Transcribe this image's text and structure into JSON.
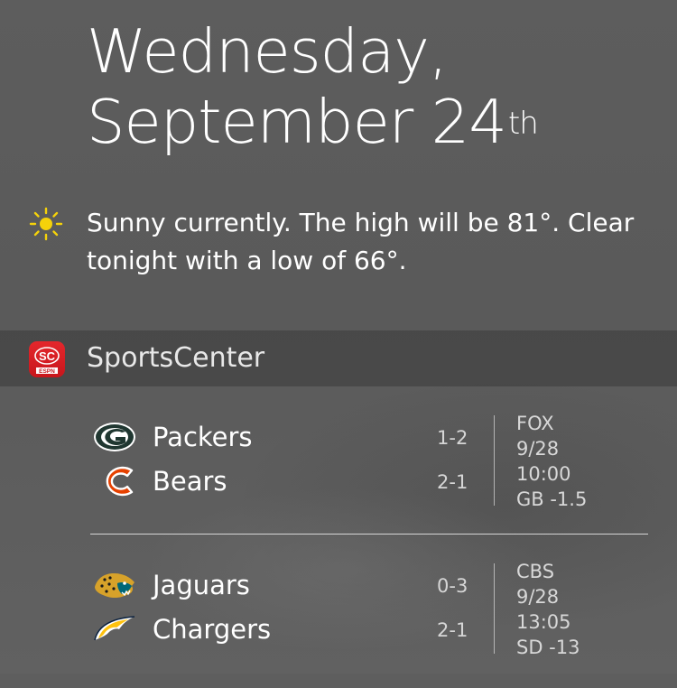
{
  "date": {
    "weekday": "Wednesday,",
    "month_day": "September 24",
    "suffix": "th"
  },
  "weather": {
    "icon": "sun-icon",
    "text": "Sunny currently. The high will be 81°. Clear tonight with a low of 66°."
  },
  "section": {
    "app_icon": "sportscenter-app-icon",
    "icon_badge": "SC",
    "icon_sub": "ESPN",
    "title": "SportsCenter"
  },
  "games": [
    {
      "teams": [
        {
          "name": "Packers",
          "record": "1-2",
          "logo": "packers-logo-icon"
        },
        {
          "name": "Bears",
          "record": "2-1",
          "logo": "bears-logo-icon"
        }
      ],
      "info": {
        "network": "FOX",
        "date": "9/28",
        "time": "10:00",
        "line": "GB -1.5"
      }
    },
    {
      "teams": [
        {
          "name": "Jaguars",
          "record": "0-3",
          "logo": "jaguars-logo-icon"
        },
        {
          "name": "Chargers",
          "record": "2-1",
          "logo": "chargers-logo-icon"
        }
      ],
      "info": {
        "network": "CBS",
        "date": "9/28",
        "time": "13:05",
        "line": "SD -13"
      }
    }
  ],
  "colors": {
    "sun": "#f5d20a",
    "packers_green": "#203731",
    "packers_gold": "#ffb612",
    "bears_navy": "#0b162a",
    "bears_orange": "#e64100",
    "jaguars_teal": "#006778",
    "jaguars_gold": "#d7a22a",
    "chargers_gold": "#ffc20e",
    "chargers_navy": "#0c2340",
    "espn_red": "#d7141b"
  }
}
